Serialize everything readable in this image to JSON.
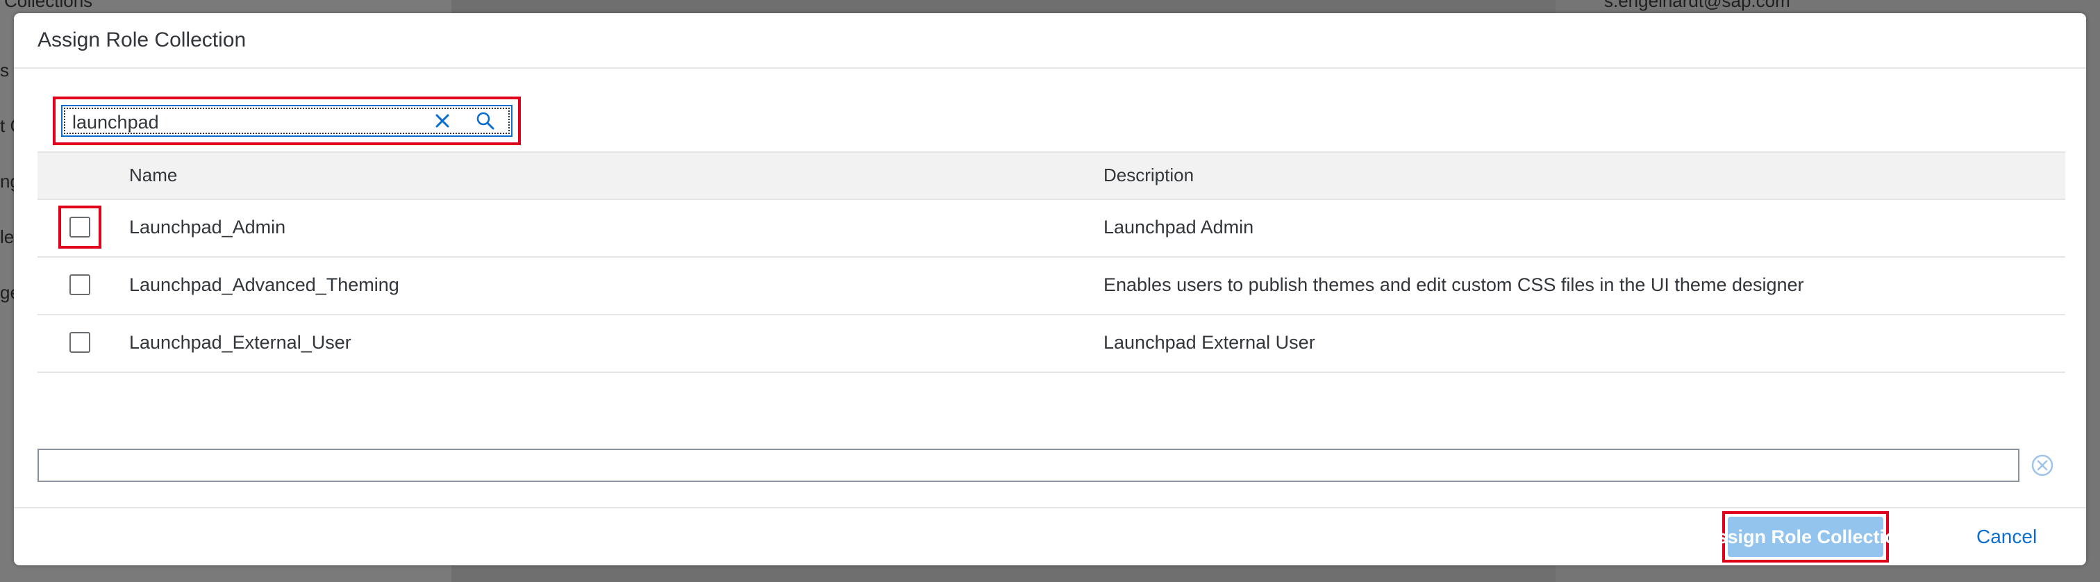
{
  "background": {
    "sidebar_fragments": [
      "Collections",
      "s",
      "t C",
      "ng",
      "le",
      "ge"
    ],
    "email": "s.engelhardt@sap.com"
  },
  "dialog": {
    "title": "Assign Role Collection",
    "search": {
      "value": "launchpad"
    },
    "table": {
      "columns": [
        "Name",
        "Description"
      ],
      "rows": [
        {
          "name": "Launchpad_Admin",
          "description": "Launchpad Admin",
          "checked": false
        },
        {
          "name": "Launchpad_Advanced_Theming",
          "description": "Enables users to publish themes and edit custom CSS files in the UI theme designer",
          "checked": false
        },
        {
          "name": "Launchpad_External_User",
          "description": "Launchpad External User",
          "checked": false
        }
      ]
    },
    "filter_input": {
      "value": ""
    },
    "footer": {
      "assign_label": "Assign Role Collection",
      "cancel_label": "Cancel"
    }
  },
  "colors": {
    "highlight": "#e0001b",
    "primary_disabled": "#92c4ee",
    "link": "#0a6ed1"
  },
  "icons": {
    "search_clear": "close-icon",
    "search": "search-icon",
    "filter_clear": "clear-circle-icon"
  }
}
